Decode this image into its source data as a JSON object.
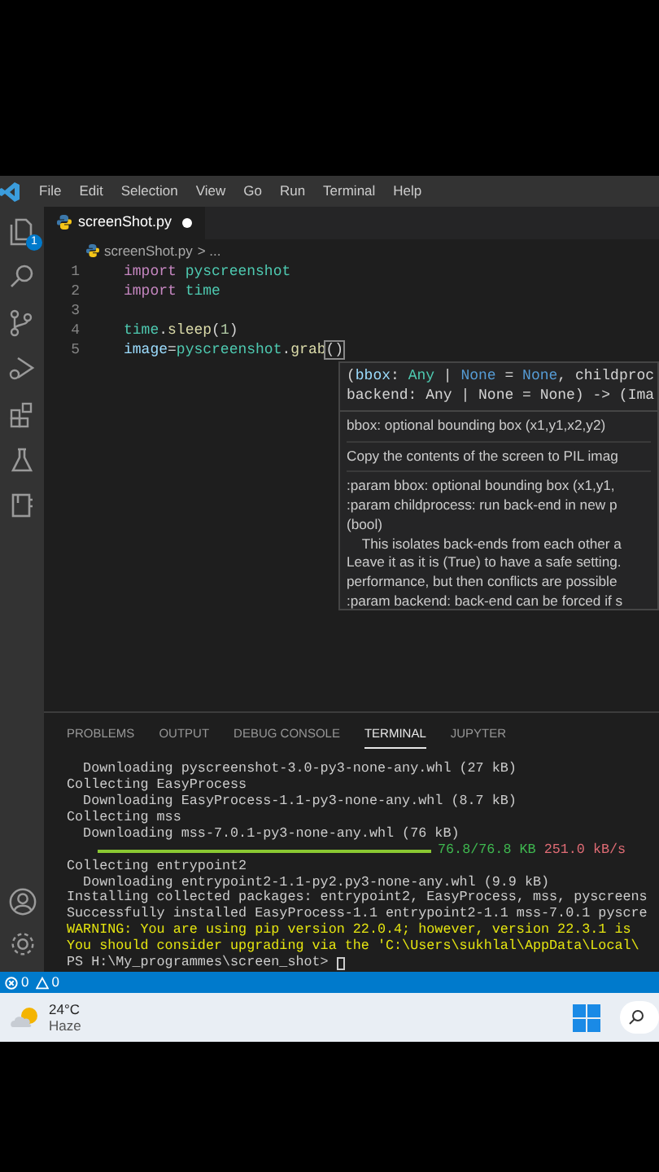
{
  "menu_bar": {
    "items": [
      "File",
      "Edit",
      "Selection",
      "View",
      "Go",
      "Run",
      "Terminal",
      "Help"
    ]
  },
  "activity_bar": {
    "items": [
      {
        "kind": "files",
        "badge": "1",
        "selected": false
      },
      {
        "kind": "search",
        "selected": false
      },
      {
        "kind": "branch",
        "selected": false
      },
      {
        "kind": "debug",
        "selected": false
      },
      {
        "kind": "extensions",
        "selected": false
      },
      {
        "kind": "flask",
        "selected": false
      },
      {
        "kind": "notebook",
        "selected": false
      }
    ],
    "bottom": [
      {
        "kind": "account"
      },
      {
        "kind": "gear"
      }
    ]
  },
  "editor": {
    "tab": {
      "label": "screenShot.py",
      "dirty": true
    },
    "breadcrumb": {
      "file": "screenShot.py",
      "rest": "> ..."
    },
    "lines": [
      {
        "number": "1",
        "tokens": [
          {
            "text": "import ",
            "kind": "keyword"
          },
          {
            "text": "pyscreenshot",
            "kind": "module"
          }
        ]
      },
      {
        "number": "2",
        "tokens": [
          {
            "text": "import ",
            "kind": "keyword"
          },
          {
            "text": "time",
            "kind": "module"
          }
        ]
      },
      {
        "number": "3"
      },
      {
        "number": "4",
        "tokens": [
          {
            "text": "time",
            "kind": "module"
          },
          {
            "text": ".",
            "kind": "plain"
          },
          {
            "text": "sleep",
            "kind": "function"
          },
          {
            "text": "(",
            "kind": "plain"
          },
          {
            "text": "1",
            "kind": "number"
          },
          {
            "text": ")",
            "kind": "plain"
          }
        ]
      },
      {
        "number": "5",
        "tokens": [
          {
            "text": "image",
            "kind": "variable"
          },
          {
            "text": "=",
            "kind": "plain"
          },
          {
            "text": "pyscreenshot",
            "kind": "module"
          },
          {
            "text": ".",
            "kind": "plain"
          },
          {
            "text": "grab",
            "kind": "function"
          },
          {
            "text": "()",
            "kind": "bracket"
          }
        ]
      }
    ]
  },
  "hover": {
    "signature": [
      [
        {
          "text": "(",
          "kind": "plain"
        },
        {
          "text": "bbox",
          "kind": "variable"
        },
        {
          "text": ": ",
          "kind": "plain"
        },
        {
          "text": "Any",
          "kind": "module"
        },
        {
          "text": " | ",
          "kind": "plain"
        },
        {
          "text": "None",
          "kind": "constant"
        },
        {
          "text": " = ",
          "kind": "plain"
        },
        {
          "text": "None",
          "kind": "constant"
        },
        {
          "text": ", childproc",
          "kind": "plain"
        }
      ],
      [
        {
          "text": "backend: Any | None = None) -> (Ima",
          "kind": "plain"
        }
      ]
    ],
    "doc": [
      [
        "bbox: optional bounding box (x1,y1,x2,y2)"
      ],
      [
        "Copy the contents of the screen to PIL imag"
      ],
      [
        ":param bbox: optional bounding box (x1,y1,",
        ":param childprocess: run back-end in new p",
        "(bool)",
        "    This isolates back-ends from each other a",
        "Leave it as it is (True) to have a safe setting.",
        "performance, but then conflicts are possible",
        ":param backend: back-end can be forced if s"
      ]
    ]
  },
  "panel": {
    "tabs": [
      {
        "label": "PROBLEMS",
        "selected": false
      },
      {
        "label": "OUTPUT",
        "selected": false
      },
      {
        "label": "DEBUG CONSOLE",
        "selected": false
      },
      {
        "label": "TERMINAL",
        "selected": true
      },
      {
        "label": "JUPYTER",
        "selected": false
      }
    ],
    "terminal": [
      {
        "kind": "text",
        "text": "  Downloading pyscreenshot-3.0-py3-none-any.whl (27 kB)"
      },
      {
        "kind": "text",
        "text": "Collecting EasyProcess"
      },
      {
        "kind": "text",
        "text": "  Downloading EasyProcess-1.1-py3-none-any.whl (8.7 kB)"
      },
      {
        "kind": "text",
        "text": "Collecting mss"
      },
      {
        "kind": "text",
        "text": "  Downloading mss-7.0.1-py3-none-any.whl (76 kB)"
      },
      {
        "kind": "progress",
        "level": 1,
        "size": "76.8/76.8 KB",
        "speed": "251.0 kB/s"
      },
      {
        "kind": "text",
        "text": "Collecting entrypoint2"
      },
      {
        "kind": "text",
        "text": "  Downloading entrypoint2-1.1-py2.py3-none-any.whl (9.9 kB)"
      },
      {
        "kind": "text",
        "text": "Installing collected packages: entrypoint2, EasyProcess, mss, pyscreens"
      },
      {
        "kind": "text",
        "text": "Successfully installed EasyProcess-1.1 entrypoint2-1.1 mss-7.0.1 pyscre"
      },
      {
        "kind": "warning",
        "text": "WARNING: You are using pip version 22.0.4; however, version 22.3.1 is"
      },
      {
        "kind": "warning",
        "text": "You should consider upgrading via the 'C:\\Users\\sukhlal\\AppData\\Local\\"
      },
      {
        "kind": "prompt",
        "text": "PS H:\\My_programmes\\screen_shot> "
      }
    ]
  },
  "status_bar": {
    "errors": "0",
    "warnings": "0"
  },
  "taskbar": {
    "temperature": "24°C",
    "weather": "Haze"
  }
}
